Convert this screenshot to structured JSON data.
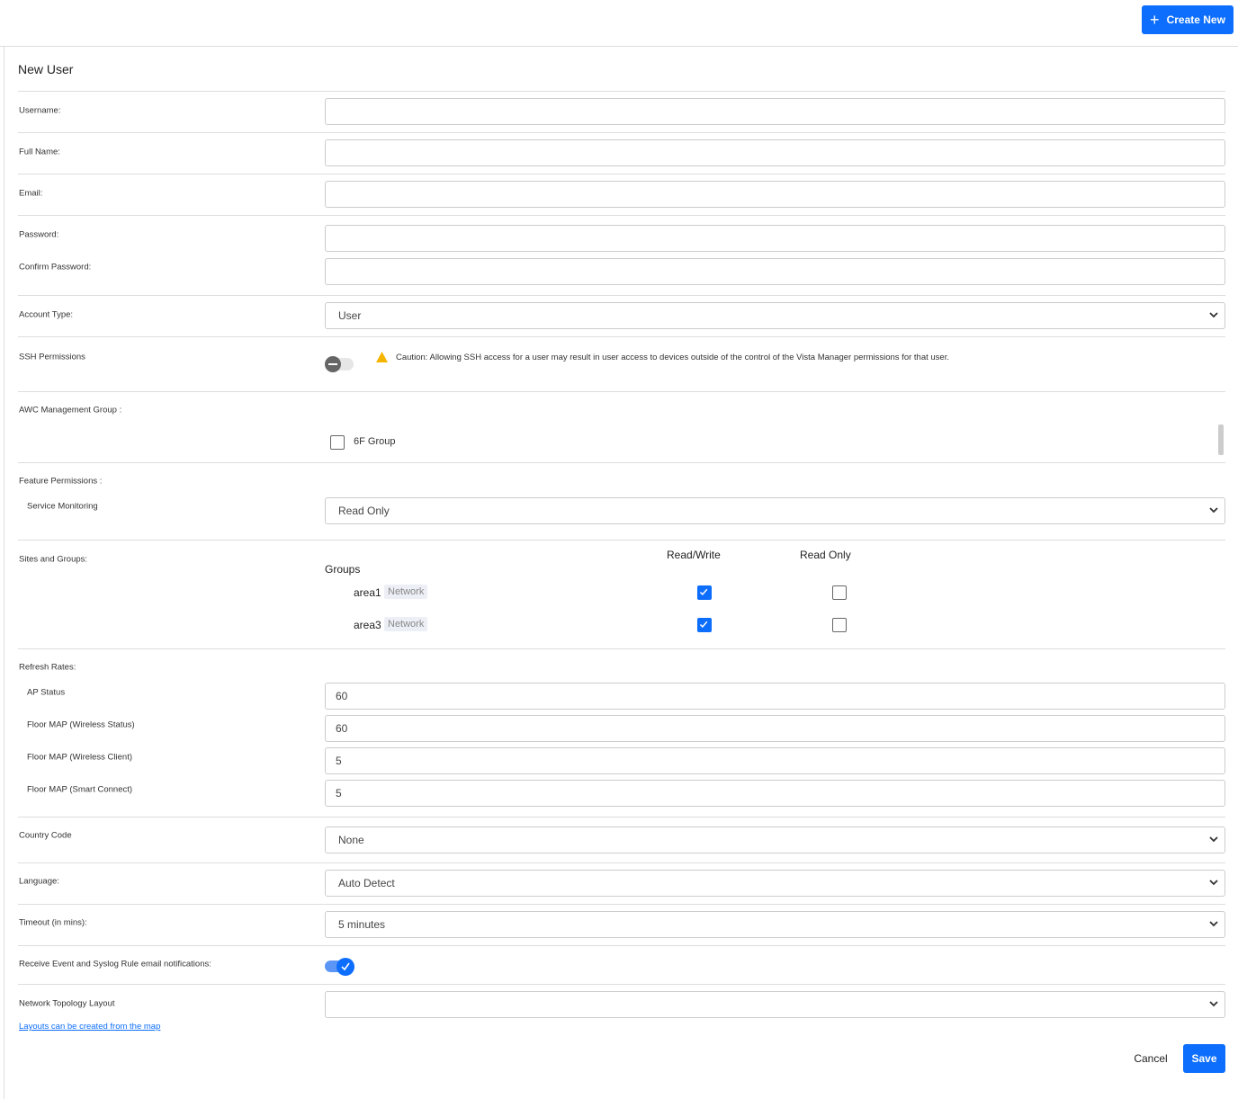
{
  "header": {
    "create_new_label": "Create New"
  },
  "form": {
    "title": "New User",
    "username": {
      "label": "Username:",
      "value": ""
    },
    "full_name": {
      "label": "Full Name:",
      "value": ""
    },
    "email": {
      "label": "Email:",
      "value": ""
    },
    "password": {
      "label": "Password:",
      "value": ""
    },
    "confirm_password": {
      "label": "Confirm Password:",
      "value": ""
    },
    "account_type": {
      "label": "Account Type:",
      "value": "User"
    },
    "ssh": {
      "label": "SSH Permissions",
      "enabled": false,
      "caution": "Caution: Allowing SSH access for a user may result in user access to devices outside of the control of the Vista Manager permissions for that user."
    },
    "awc": {
      "label": "AWC Management Group :",
      "groups": [
        {
          "name": "6F Group",
          "checked": false
        }
      ]
    },
    "feature_permissions": {
      "label": "Feature Permissions :",
      "service_monitoring": {
        "label": "Service Monitoring",
        "value": "Read Only"
      }
    },
    "sites_groups": {
      "label": "Sites and Groups:",
      "groups_header": "Groups",
      "rw_header": "Read/Write",
      "ro_header": "Read Only",
      "rows": [
        {
          "name": "area1",
          "tag": "Network",
          "rw": true,
          "ro": false
        },
        {
          "name": "area3",
          "tag": "Network",
          "rw": true,
          "ro": false
        }
      ]
    },
    "refresh": {
      "label": "Refresh Rates:",
      "items": [
        {
          "label": "AP Status",
          "value": "60"
        },
        {
          "label": "Floor MAP (Wireless Status)",
          "value": "60"
        },
        {
          "label": "Floor MAP (Wireless Client)",
          "value": "5"
        },
        {
          "label": "Floor MAP (Smart Connect)",
          "value": "5"
        }
      ]
    },
    "country": {
      "label": "Country Code",
      "value": "None"
    },
    "language": {
      "label": "Language:",
      "value": "Auto Detect"
    },
    "timeout": {
      "label": "Timeout (in mins):",
      "value": "5 minutes"
    },
    "notifications": {
      "label": "Receive Event and Syslog Rule email notifications:",
      "enabled": true
    },
    "topology": {
      "label": "Network Topology Layout",
      "value": "",
      "link": "Layouts can be created from the map"
    },
    "cancel_label": "Cancel",
    "save_label": "Save"
  },
  "colors": {
    "accent": "#0d6efd",
    "warning": "#f5b400"
  }
}
